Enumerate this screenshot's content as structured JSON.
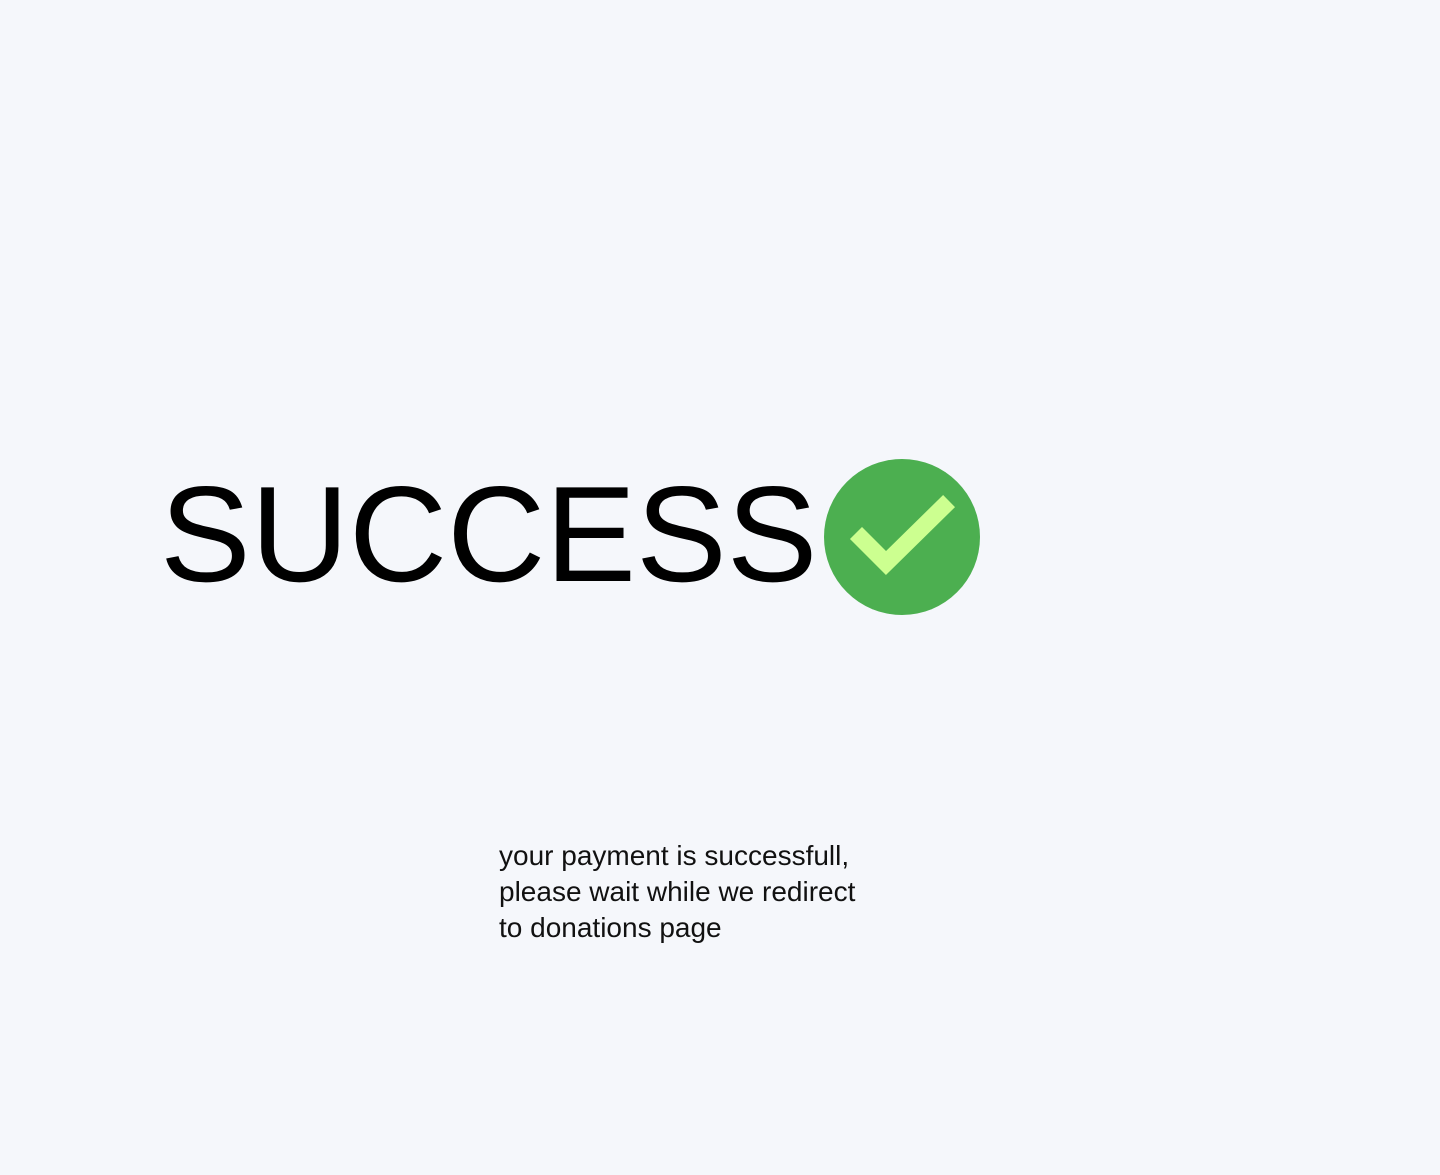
{
  "status": {
    "title": "SUCCESS",
    "icon": "check-circle-icon"
  },
  "message": {
    "lines": [
      "your payment is successfull,",
      "please wait while we redirect",
      "to donations page"
    ]
  },
  "colors": {
    "background": "#f5f7fb",
    "badge": "#4caf50",
    "checkmark": "#ccff90",
    "text": "#000000"
  }
}
